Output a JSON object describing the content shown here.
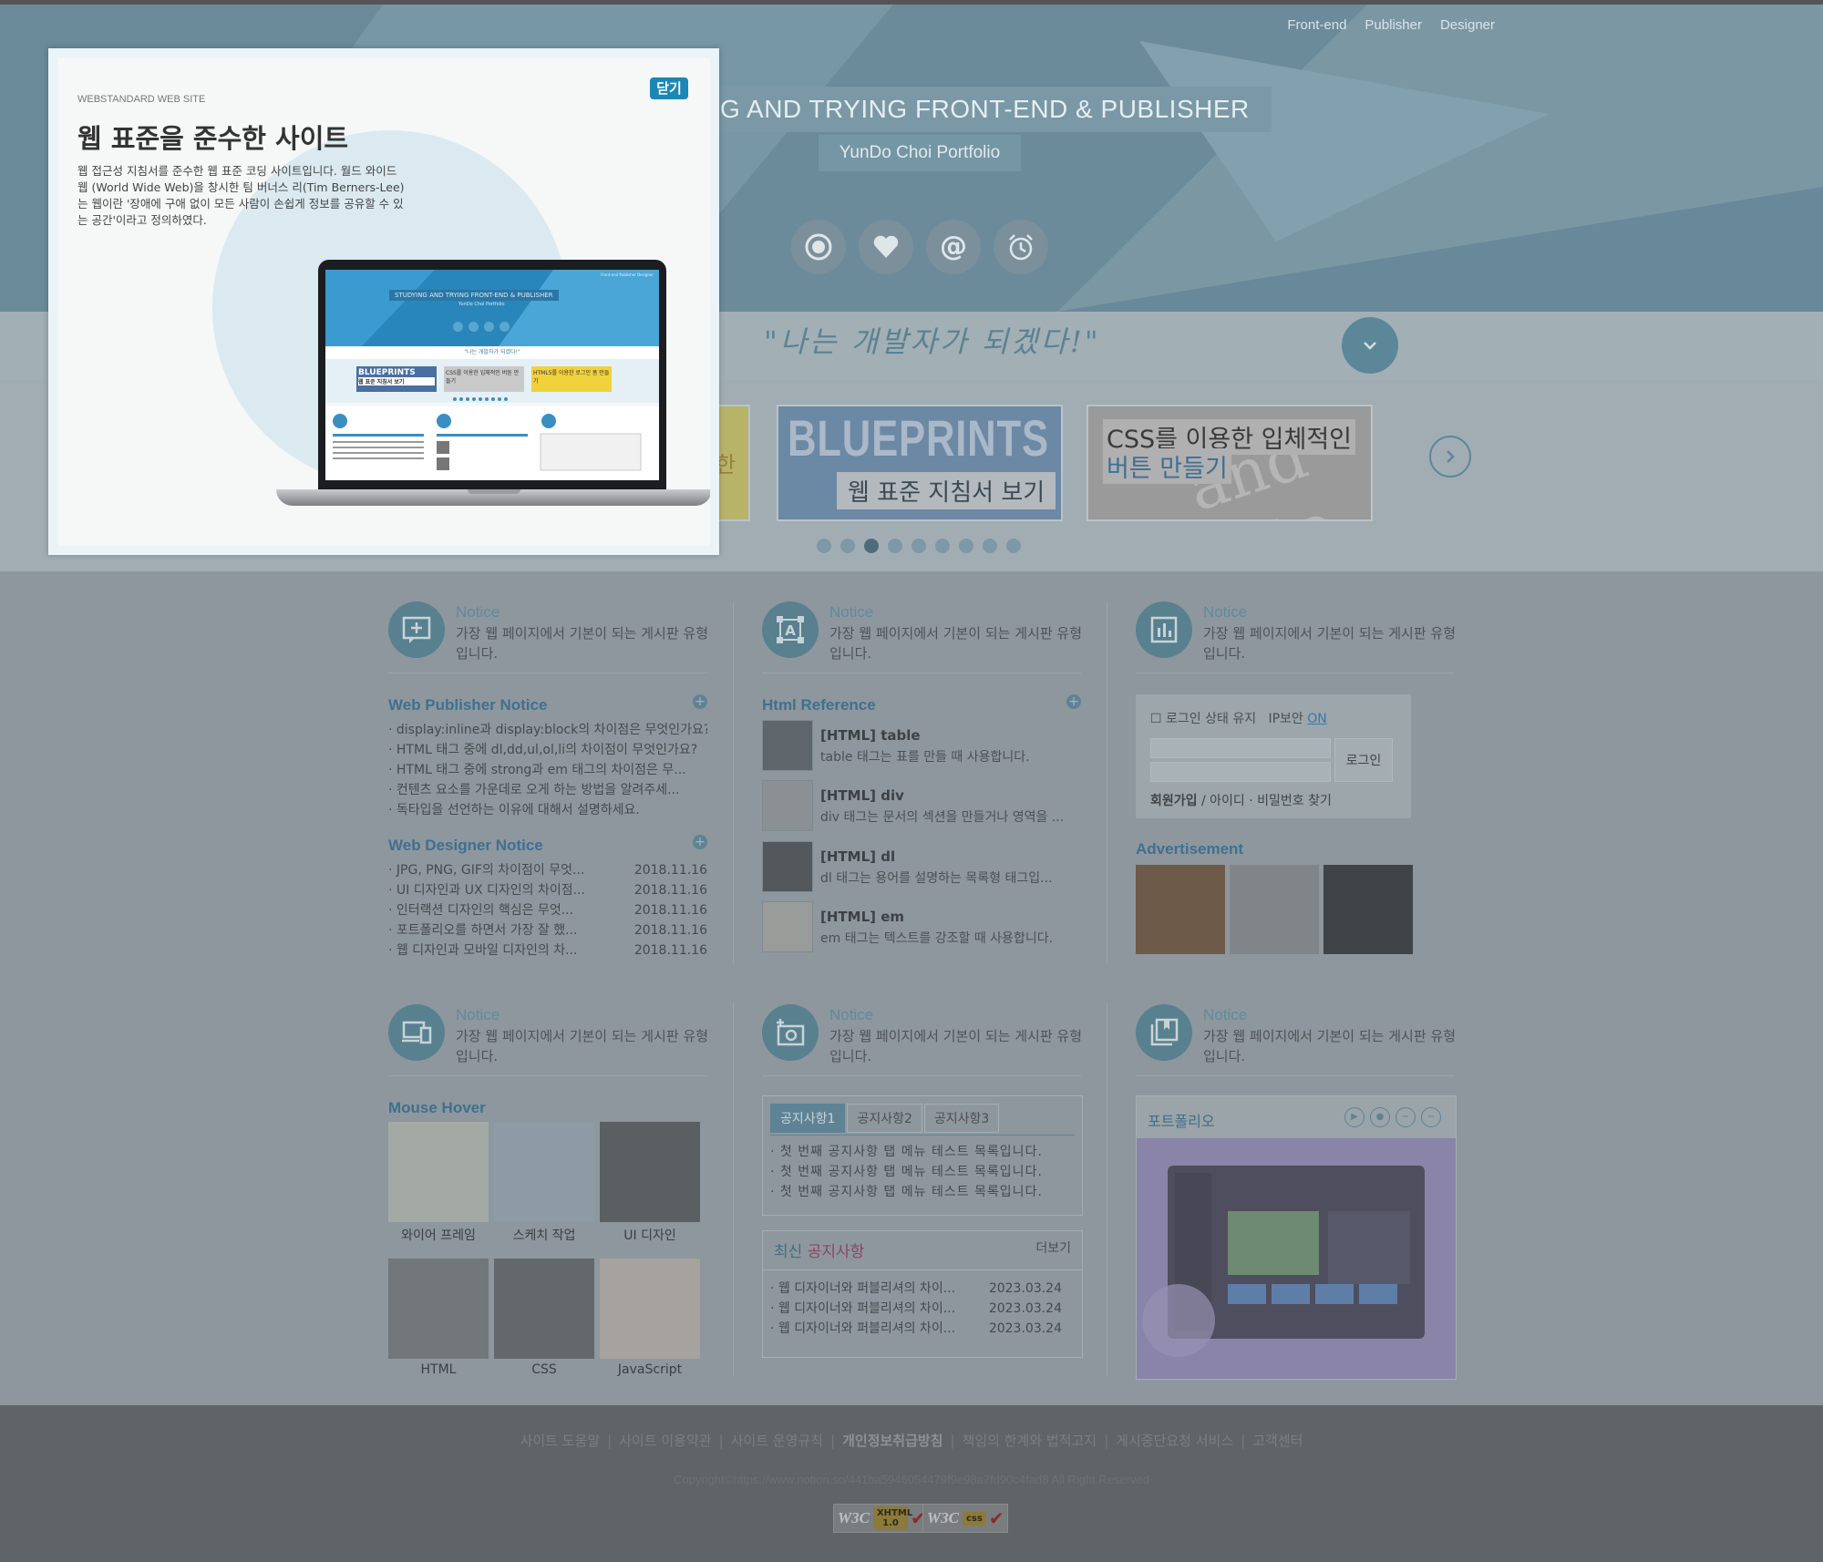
{
  "top_nav": [
    "Front-end",
    "Publisher",
    "Designer"
  ],
  "hero": {
    "title": "G AND TRYING FRONT-END & PUBLISHER",
    "subtitle": "YunDo Choi Portfolio",
    "icons": [
      "record-icon",
      "heart-icon",
      "at-icon",
      "alarm-clock-icon"
    ]
  },
  "quote": "\"나는 개발자가 되겠다!\"",
  "slider": {
    "slides": [
      {
        "big": "",
        "label": "한"
      },
      {
        "big": "BLUEPRINTS",
        "label": "웹 표준 지침서 보기"
      },
      {
        "line1": "CSS를 이용한 입체적인",
        "line2": "버튼 만들기",
        "ghost": "and inte"
      }
    ],
    "dot_count": 9,
    "active_dot": 2
  },
  "notice_cards": [
    {
      "title": "Notice",
      "desc": "가장 웹 페이지에서 기본이 되는 게시판 유형입니다.",
      "icon": "add-comment-icon"
    },
    {
      "title": "Notice",
      "desc": "가장 웹 페이지에서 기본이 되는 게시판 유형입니다.",
      "icon": "frame-a-icon"
    },
    {
      "title": "Notice",
      "desc": "가장 웹 페이지에서 기본이 되는 게시판 유형입니다.",
      "icon": "bar-chart-icon"
    },
    {
      "title": "Notice",
      "desc": "가장 웹 페이지에서 기본이 되는 게시판 유형입니다.",
      "icon": "devices-icon"
    },
    {
      "title": "Notice",
      "desc": "가장 웹 페이지에서 기본이 되는 게시판 유형입니다.",
      "icon": "add-camera-icon"
    },
    {
      "title": "Notice",
      "desc": "가장 웹 페이지에서 기본이 되는 게시판 유형입니다.",
      "icon": "bookmark-book-icon"
    }
  ],
  "web_publisher": {
    "title": "Web Publisher Notice",
    "items": [
      "display:inline과 display:block의 차이점은 무엇인가요?",
      "HTML 태그 중에 dl,dd,ul,ol,li의 차이점이 무엇인가요?",
      "HTML 태그 중에 strong과 em 태그의 차이점은 무...",
      "컨텐츠 요소를 가운데로 오게 하는 방법을 알려주세...",
      "독타입을 선언하는 이유에 대해서 설명하세요."
    ]
  },
  "web_designer": {
    "title": "Web Designer Notice",
    "items": [
      {
        "text": "JPG, PNG, GIF의 차이점이 무엇...",
        "date": "2018.11.16"
      },
      {
        "text": "UI 디자인과 UX 디자인의 차이점...",
        "date": "2018.11.16"
      },
      {
        "text": "인터랙션 디자인의 핵심은 무엇...",
        "date": "2018.11.16"
      },
      {
        "text": "포트폴리오를 하면서 가장 잘 했...",
        "date": "2018.11.16"
      },
      {
        "text": "웹 디자인과 모바일 디자인의 차...",
        "date": "2018.11.16"
      }
    ]
  },
  "html_reference": {
    "title": "Html Reference",
    "items": [
      {
        "title": "[HTML] table",
        "desc": "table 태그는 표를 만들 때 사용합니다."
      },
      {
        "title": "[HTML] div",
        "desc": "div 태그는 문서의 섹션을 만들거나 영역을 ..."
      },
      {
        "title": "[HTML] dl",
        "desc": "dl 태그는 용어를 설명하는 목록형 태그입..."
      },
      {
        "title": "[HTML] em",
        "desc": "em 태그는 텍스트를 강조할 때 사용합니다."
      }
    ]
  },
  "login": {
    "keep_label": "로그인 상태 유지",
    "ip_label": "IP보안",
    "ip_state": "ON",
    "button": "로그인",
    "signup": "회원가입",
    "find": "아이디 · 비밀번호 찾기"
  },
  "advertisement": {
    "title": "Advertisement"
  },
  "mouse_hover": {
    "title": "Mouse Hover",
    "items": [
      "와이어 프레임",
      "스케치 작업",
      "UI 디자인",
      "HTML",
      "CSS",
      "JavaScript"
    ]
  },
  "tabs": {
    "labels": [
      "공지사항1",
      "공지사항2",
      "공지사항3"
    ],
    "active": 0,
    "items": [
      "첫 번째 공지사항 탭 메뉴 테스트 목록입니다.",
      "첫 번째 공지사항 탭 메뉴 테스트 목록입니다.",
      "첫 번째 공지사항 탭 메뉴 테스트 목록입니다."
    ]
  },
  "latest": {
    "title_a": "최신",
    "title_b": "공지사항",
    "more": "더보기",
    "items": [
      {
        "text": "웹 디자이너와 퍼블리셔의 차이...",
        "date": "2023.03.24"
      },
      {
        "text": "웹 디자이너와 퍼블리셔의 차이...",
        "date": "2023.03.24"
      },
      {
        "text": "웹 디자이너와 퍼블리셔의 차이...",
        "date": "2023.03.24"
      }
    ]
  },
  "portfolio": {
    "title": "포트폴리오",
    "controls": [
      "play-icon",
      "stop-icon",
      "prev-icon",
      "next-icon"
    ]
  },
  "footer": {
    "links": [
      "사이트 도움말",
      "사이트 이용약관",
      "사이트 운영규칙",
      "개인정보취급방침",
      "책임의 한계와 법적고지",
      "게시중단요청 서비스",
      "고객센터"
    ],
    "bold_index": 3,
    "copyright": "Copyright©https://www.notion.so/441ba5946054479f9e98a7fd90c4fad8 All Right Reserved",
    "badges": [
      {
        "w3c": "W3C",
        "tag": "XHTML 1.0"
      },
      {
        "w3c": "W3C",
        "tag": "css"
      }
    ]
  },
  "modal": {
    "kicker": "WEBSTANDARD WEB SITE",
    "title": "웹 표준을 준수한 사이트",
    "desc": "웹 접근성 지침서를 준수한 웹 표준 코딩 사이트입니다. 월드 와이드 웹 (World Wide Web)을 창시한 팀 버너스 리(Tim Berners-Lee)는 웹이란 '장애에 구애 없이 모든 사람이 손쉽게 정보를 공유할 수 있는 공간'이라고 정의하였다.",
    "close": "닫기",
    "mini_title": "STUDYING AND TRYING FRONT-END & PUBLISHER",
    "mini_sub": "YunDo Choi Portfolio",
    "mini_quote": "\"나는 개발자가 되겠다!\"",
    "mini_nav": "Front-end  Publisher  Designer",
    "mini_slide1": "BLUEPRINTS",
    "mini_slide1b": "웹 표준 지침서 보기",
    "mini_slide2": "CSS를 이용한 입체적인 버튼 만들기",
    "mini_slide3": "HTML5를 이용한 로그인 폼 만들기"
  }
}
